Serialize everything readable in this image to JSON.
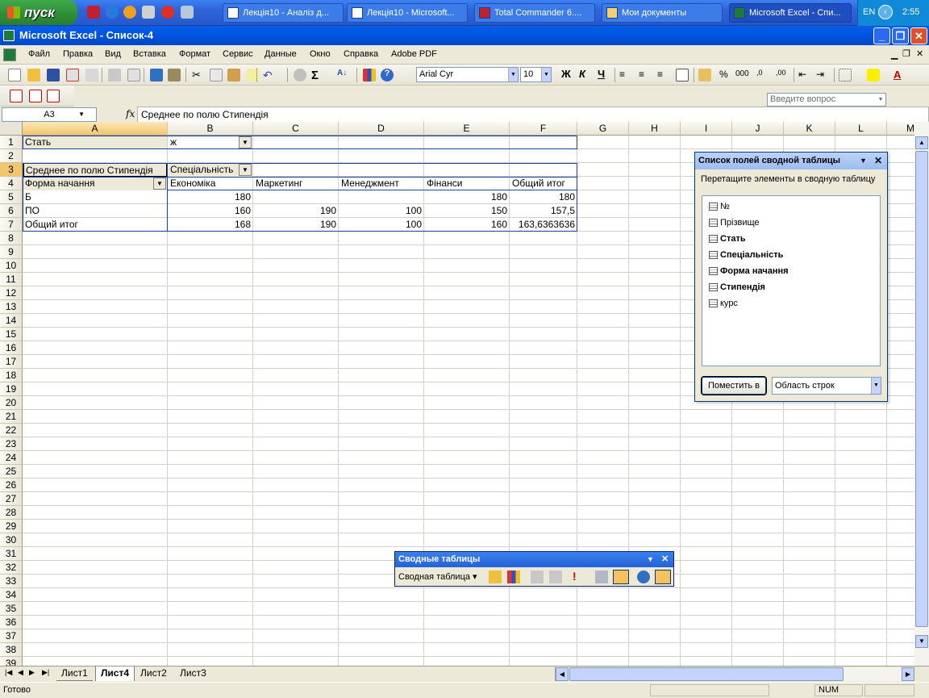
{
  "taskbar": {
    "start_label": "пуск",
    "tasks": [
      {
        "label": "Лекція10 - Аналіз д..."
      },
      {
        "label": "Лекція10 - Microsoft..."
      },
      {
        "label": "Total Commander 6...."
      },
      {
        "label": "Мои документы"
      },
      {
        "label": "Microsoft Excel - Спи..."
      }
    ],
    "lang": "EN",
    "clock": "2:55"
  },
  "window": {
    "title": "Microsoft Excel - Список-4"
  },
  "menu": {
    "items": [
      "Файл",
      "Правка",
      "Вид",
      "Вставка",
      "Формат",
      "Сервис",
      "Данные",
      "Окно",
      "Справка",
      "Adobe PDF"
    ],
    "ask_placeholder": "Введите вопрос"
  },
  "toolbar": {
    "font_name": "Arial Cyr",
    "font_size": "10",
    "bold": "Ж",
    "italic": "К",
    "underline": "Ч",
    "percent": "%",
    "thousands": "000"
  },
  "formula_bar": {
    "name_box": "A3",
    "fx": "fx",
    "content": "Среднее по полю Стипендія"
  },
  "columns": [
    "A",
    "B",
    "C",
    "D",
    "E",
    "F",
    "G",
    "H",
    "I",
    "J",
    "K",
    "L",
    "M"
  ],
  "rows": [
    "1",
    "2",
    "3",
    "4",
    "5",
    "6",
    "7",
    "8",
    "9",
    "10",
    "11",
    "12",
    "13",
    "14",
    "15",
    "16",
    "17",
    "18",
    "19",
    "20",
    "21",
    "22",
    "23",
    "24",
    "25",
    "26",
    "27",
    "28",
    "29",
    "30",
    "31",
    "32",
    "33",
    "34",
    "35",
    "36",
    "37",
    "38",
    "39"
  ],
  "pivot": {
    "page_field": "Стать",
    "page_value": "ж",
    "data_field": "Среднее по полю Стипендія",
    "col_field": "Спеціальність",
    "row_field": "Форма начання",
    "col_items": [
      "Економіка",
      "Маркетинг",
      "Менеджмент",
      "Фінанси",
      "Общий итог"
    ],
    "rows": [
      {
        "label": "Б",
        "values": [
          "180",
          "",
          "",
          "180",
          "180"
        ]
      },
      {
        "label": "ПО",
        "values": [
          "160",
          "190",
          "100",
          "150",
          "157,5"
        ]
      },
      {
        "label": "Общий итог",
        "values": [
          "168",
          "190",
          "100",
          "160",
          "163,6363636"
        ]
      }
    ]
  },
  "field_list": {
    "title": "Список полей сводной таблицы",
    "instruction": "Перетащите элементы в сводную таблицу",
    "fields": [
      {
        "label": "№",
        "bold": false
      },
      {
        "label": "Прізвище",
        "bold": false
      },
      {
        "label": "Стать",
        "bold": true
      },
      {
        "label": "Спеціальність",
        "bold": true
      },
      {
        "label": "Форма начання",
        "bold": true
      },
      {
        "label": "Стипендія",
        "bold": true
      },
      {
        "label": "курс",
        "bold": false
      }
    ],
    "button_label": "Поместить в",
    "area_value": "Область строк"
  },
  "pivot_toolbar": {
    "title": "Сводные таблицы",
    "menu_label": "Сводная таблица"
  },
  "sheets": {
    "tabs": [
      "Лист1",
      "Лист4",
      "Лист2",
      "Лист3"
    ],
    "active": "Лист4"
  },
  "status": {
    "text": "Готово",
    "num": "NUM"
  }
}
